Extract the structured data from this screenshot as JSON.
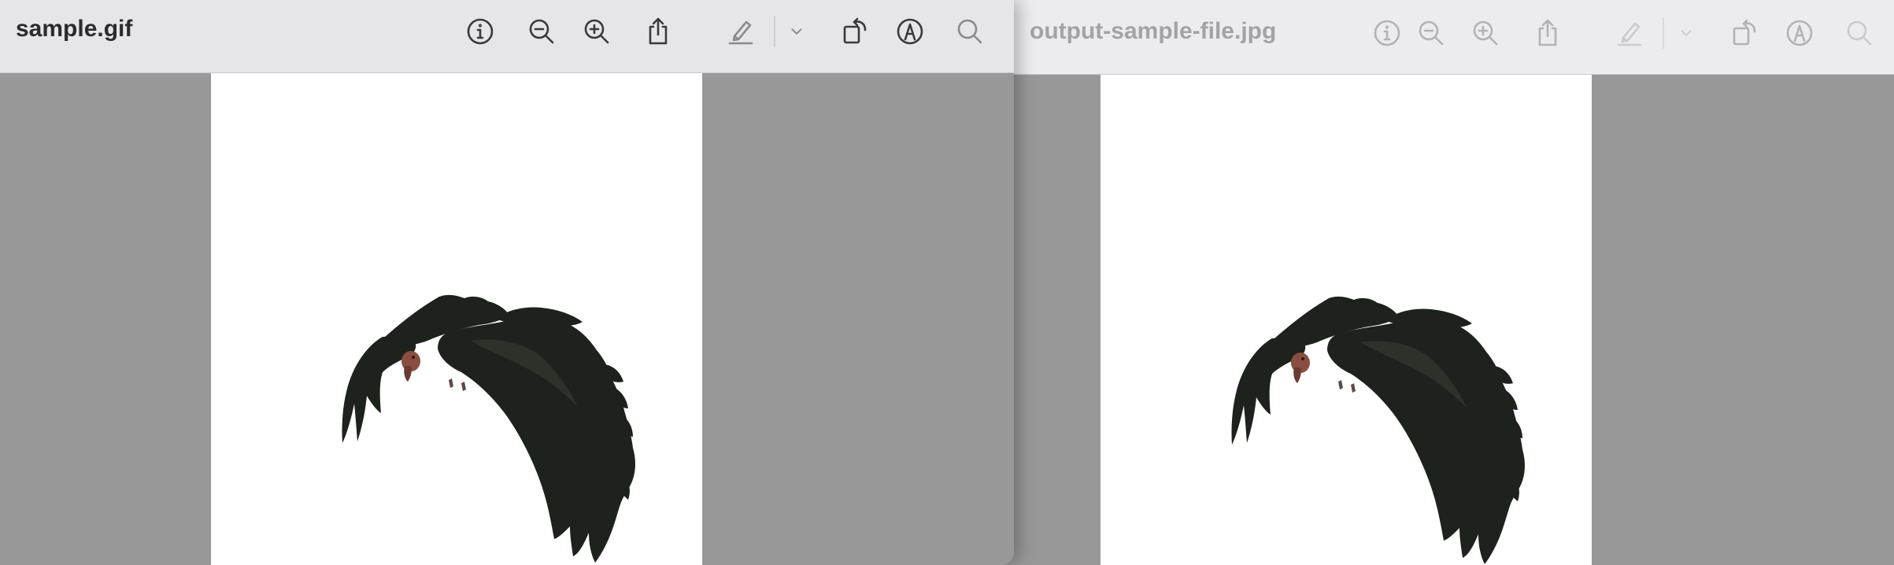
{
  "windows": [
    {
      "title": "sample.gif",
      "active": true,
      "toolbar_icons": [
        "info-icon",
        "zoom-out-icon",
        "zoom-in-icon",
        "share-icon",
        "highlight-pen-icon",
        "chevron-down-icon",
        "rotate-icon",
        "markup-icon",
        "search-icon"
      ]
    },
    {
      "title": "output-sample-file.jpg",
      "active": false,
      "toolbar_icons": [
        "info-icon",
        "zoom-out-icon",
        "zoom-in-icon",
        "share-icon",
        "highlight-pen-icon",
        "chevron-down-icon",
        "rotate-icon",
        "markup-icon",
        "search-icon"
      ]
    }
  ],
  "colors": {
    "toolbar_active": "#e6e6e8",
    "toolbar_inactive": "#ececee",
    "canvas_background": "#989898",
    "page_background": "#ffffff",
    "bird_body": "#1e221c",
    "bird_head": "#8a4e40"
  }
}
